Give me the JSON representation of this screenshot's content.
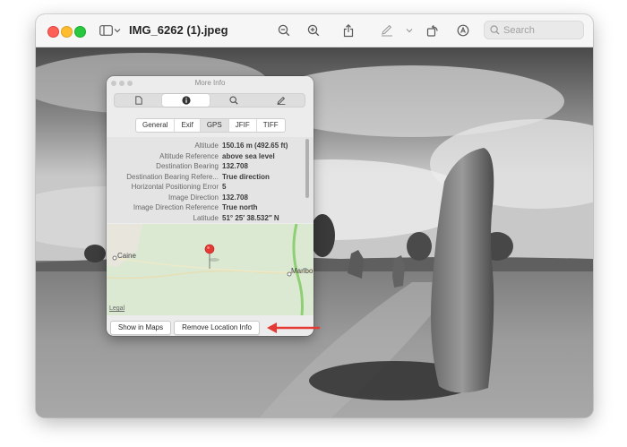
{
  "window": {
    "title": "IMG_6262 (1).jpeg",
    "search_placeholder": "Search"
  },
  "toolbar_icons": [
    "sidebar-icon",
    "chevron-down-icon",
    "zoom-out-icon",
    "zoom-in-icon",
    "share-icon",
    "markup-pen-icon",
    "chevron-down-icon",
    "rotate-icon",
    "markup-circle-icon",
    "search-icon"
  ],
  "info_panel": {
    "title": "More Info",
    "segments": [
      "document-icon",
      "info-icon",
      "search-icon",
      "pencil-icon"
    ],
    "tabs": [
      "General",
      "Exif",
      "GPS",
      "JFIF",
      "TIFF"
    ],
    "active_tab": "GPS",
    "properties": [
      {
        "key": "Altitude",
        "value": "150.16 m (492.65 ft)"
      },
      {
        "key": "Altitude Reference",
        "value": "above sea level"
      },
      {
        "key": "Destination Bearing",
        "value": "132.708"
      },
      {
        "key": "Destination Bearing Refere...",
        "value": "True direction"
      },
      {
        "key": "Horizontal Positioning Error",
        "value": "5"
      },
      {
        "key": "Image Direction",
        "value": "132.708"
      },
      {
        "key": "Image Direction Reference",
        "value": "True north"
      },
      {
        "key": "Latitude",
        "value": "51° 25′ 38.532″ N"
      }
    ],
    "map": {
      "places": [
        "Caine",
        "Marlbo"
      ],
      "legal": "Legal",
      "colors": {
        "land": "#dbe9d3",
        "road": "#8fcf74",
        "pin": "#e53935"
      }
    },
    "buttons": {
      "show_in_maps": "Show in Maps",
      "remove_location": "Remove Location Info"
    }
  },
  "annotation": {
    "arrow_color": "#e53935",
    "points_to": "remove-location-button"
  }
}
